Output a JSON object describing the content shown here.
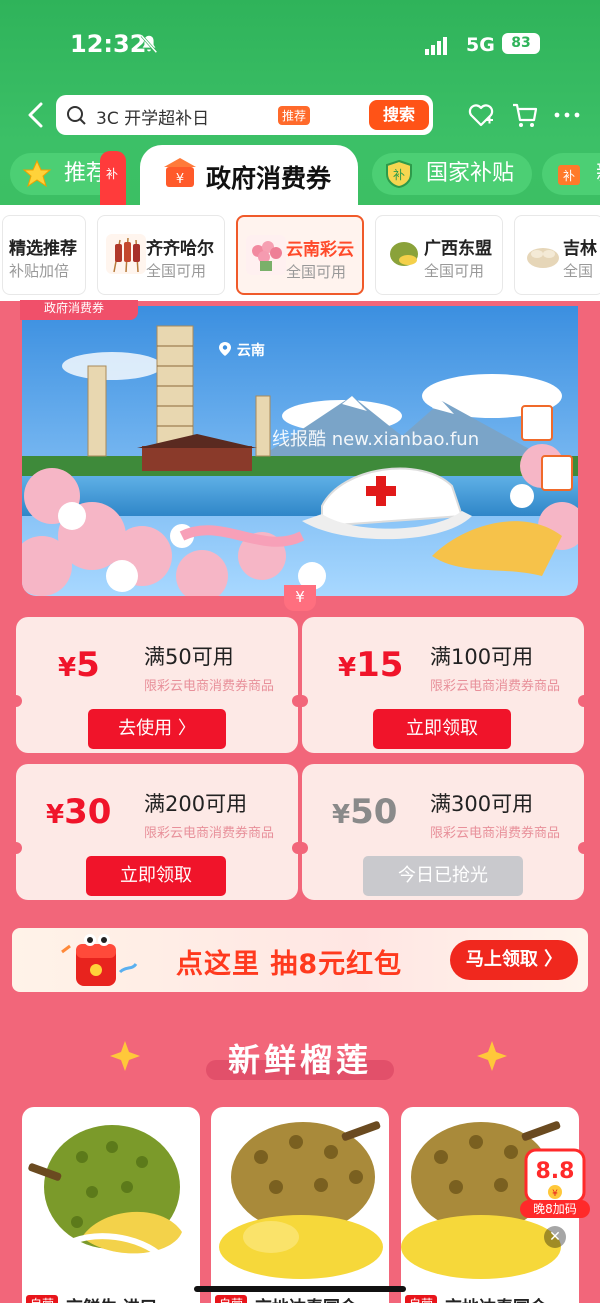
{
  "status_bar": {
    "time": "12:32",
    "network": "5G",
    "battery": "83"
  },
  "search": {
    "query": "3C 开学超补日",
    "badge": "推荐",
    "button": "搜索"
  },
  "tabs": [
    {
      "label": "推荐",
      "bubble": "补贴"
    },
    {
      "label": "政府消费券"
    },
    {
      "label": "国家补贴"
    },
    {
      "label": "新"
    }
  ],
  "categories": [
    {
      "title": "精选推荐",
      "subtitle": "补贴加倍"
    },
    {
      "title": "齐齐哈尔",
      "subtitle": "全国可用"
    },
    {
      "title": "云南彩云",
      "subtitle": "全国可用"
    },
    {
      "title": "广西东盟",
      "subtitle": "全国可用"
    },
    {
      "title": "吉林",
      "subtitle": "全国"
    }
  ],
  "banner": {
    "tag": "政府消费券",
    "location": "云南",
    "watermark": "线报酷 new.xianbao.fun"
  },
  "coupon_divider": "¥",
  "coupons": [
    {
      "currency": "¥",
      "amount": "5",
      "condition": "满50可用",
      "limit": "限彩云电商消费券商品",
      "button": "去使用 〉",
      "state": "active"
    },
    {
      "currency": "¥",
      "amount": "15",
      "condition": "满100可用",
      "limit": "限彩云电商消费券商品",
      "button": "立即领取",
      "state": "active"
    },
    {
      "currency": "¥",
      "amount": "30",
      "condition": "满200可用",
      "limit": "限彩云电商消费券商品",
      "button": "立即领取",
      "state": "active"
    },
    {
      "currency": "¥",
      "amount": "50",
      "condition": "满300可用",
      "limit": "限彩云电商消费券商品",
      "button": "今日已抢光",
      "state": "soldout"
    }
  ],
  "promo": {
    "text": "点这里 抽8元红包",
    "button": "马上领取 〉"
  },
  "section": {
    "title": "新鲜榴莲"
  },
  "products": [
    {
      "tag": "自营",
      "title": "京鲜生 进口"
    },
    {
      "tag": "自营",
      "title": "京地达泰国金"
    },
    {
      "tag": "自营",
      "title": "京地达泰国金"
    }
  ],
  "floating": {
    "amount": "8.8",
    "label": "晚8加码",
    "close": "✕"
  },
  "colors": {
    "brand_green": "#3cbf63",
    "coupon_red": "#f0142a",
    "page_pink": "#f2667a"
  }
}
